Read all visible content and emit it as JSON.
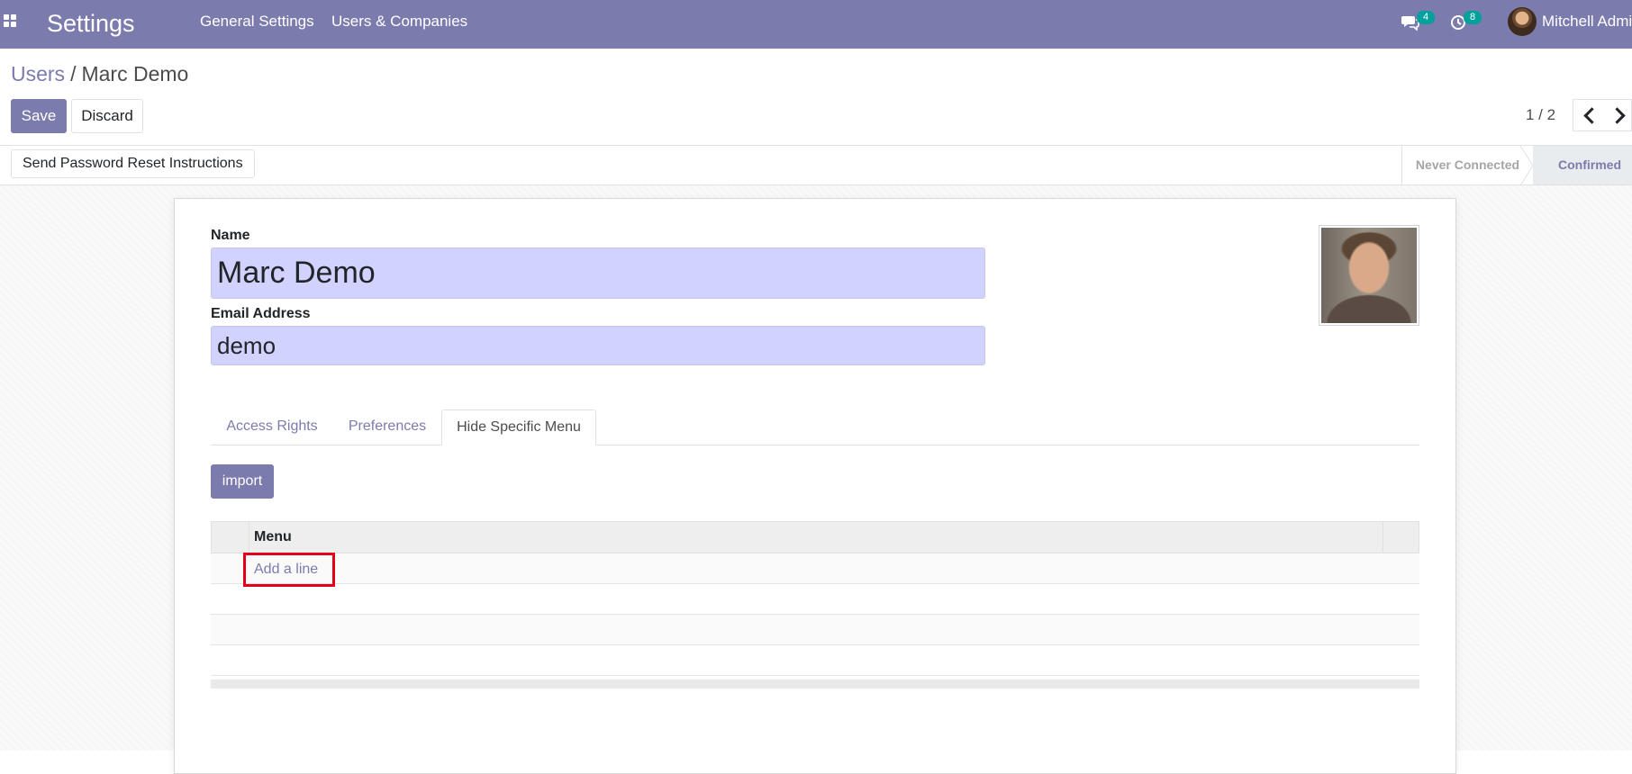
{
  "navbar": {
    "app_title": "Settings",
    "menus": [
      "General Settings",
      "Users & Companies"
    ],
    "messages_count": "4",
    "activities_count": "8",
    "user_name": "Mitchell Admin"
  },
  "breadcrumb": {
    "parent": "Users",
    "separator": "/",
    "current": "Marc Demo"
  },
  "actions": {
    "save": "Save",
    "discard": "Discard"
  },
  "pager": {
    "value": "1 / 2"
  },
  "statusbar": {
    "reset_button": "Send Password Reset Instructions",
    "stages": [
      "Never Connected",
      "Confirmed"
    ],
    "active_stage": "Confirmed"
  },
  "form": {
    "name_label": "Name",
    "name_value": "Marc Demo",
    "email_label": "Email Address",
    "email_value": "demo"
  },
  "tabs": [
    "Access Rights",
    "Preferences",
    "Hide Specific Menu"
  ],
  "active_tab": "Hide Specific Menu",
  "hide_menu": {
    "import_button": "import",
    "column_header": "Menu",
    "add_line": "Add a line"
  },
  "colors": {
    "brand": "#7c7bad",
    "input_bg": "#d2d2ff",
    "highlight": "#e4001b",
    "badge": "#00a09d"
  },
  "icons": [
    "apps-grid-icon",
    "chat-icon",
    "activity-clock-icon",
    "chevron-left-icon",
    "chevron-right-icon"
  ]
}
